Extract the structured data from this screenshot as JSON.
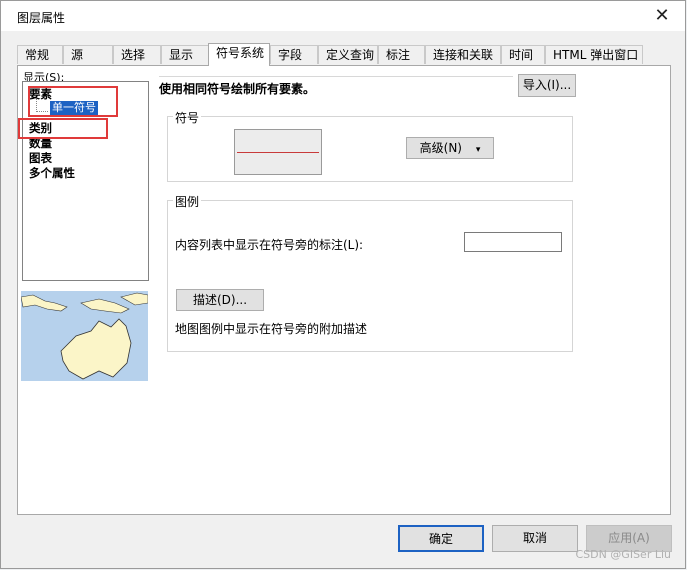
{
  "window": {
    "title": "图层属性",
    "close_glyph": "✕"
  },
  "tabs": [
    {
      "label": "常规",
      "active": false
    },
    {
      "label": "源",
      "active": false
    },
    {
      "label": "选择",
      "active": false
    },
    {
      "label": "显示",
      "active": false
    },
    {
      "label": "符号系统",
      "active": true
    },
    {
      "label": "字段",
      "active": false
    },
    {
      "label": "定义查询",
      "active": false
    },
    {
      "label": "标注",
      "active": false
    },
    {
      "label": "连接和关联",
      "active": false
    },
    {
      "label": "时间",
      "active": false
    },
    {
      "label": "HTML 弹出窗口",
      "active": false
    }
  ],
  "show_panel": {
    "label": "显示(S):",
    "items": [
      {
        "label": "要素",
        "type": "category"
      },
      {
        "label": "单一符号",
        "type": "selected"
      },
      {
        "label": "类别",
        "type": "category"
      },
      {
        "label": "数量",
        "type": "category"
      },
      {
        "label": "图表",
        "type": "category"
      },
      {
        "label": "多个属性",
        "type": "category"
      }
    ]
  },
  "main": {
    "description": "使用相同符号绘制所有要素。",
    "import_button": "导入(I)...",
    "symbol_group": {
      "title": "符号",
      "advanced_button": "高级(N)",
      "dropdown_glyph": "▾",
      "symbol_line_color": "#c83a3a",
      "swatch_bg": "#ececec"
    },
    "legend_group": {
      "title": "图例",
      "label_field": "内容列表中显示在符号旁的标注(L):",
      "label_value": "",
      "describe_button": "描述(D)...",
      "describe_caption": "地图图例中显示在符号旁的附加描述"
    }
  },
  "footer": {
    "ok": "确定",
    "cancel": "取消",
    "apply": "应用(A)"
  },
  "watermark": "CSDN @GISer Liu",
  "colors": {
    "accent": "#1d62c3",
    "highlight_box": "#e03a3a",
    "preview_water": "#b6d1ec",
    "preview_land": "#fbf5c8"
  }
}
